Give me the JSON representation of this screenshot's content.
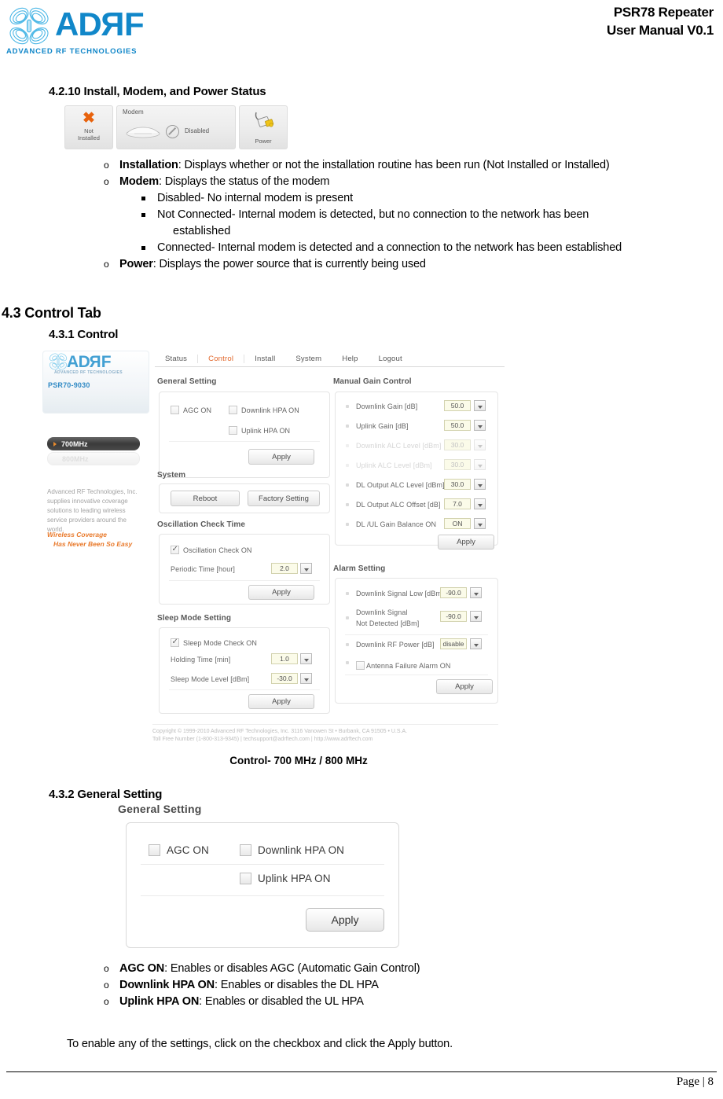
{
  "header": {
    "logo_word_left": "AD",
    "logo_word_r": "R",
    "logo_word_f": "F",
    "logo_tagline": "ADVANCED RF TECHNOLOGIES",
    "doc_title_line1": "PSR78 Repeater",
    "doc_title_line2": "User Manual V0.1"
  },
  "section_4_2_10": {
    "heading": "4.2.10 Install, Modem, and Power Status",
    "status_boxes": {
      "install": {
        "icon": "x-mark-icon",
        "label_line1": "Not",
        "label_line2": "Installed"
      },
      "modem": {
        "title": "Modem",
        "icon": "modem-device-icon",
        "prohibit_icon": "prohibited-icon",
        "status": "Disabled"
      },
      "power": {
        "icon": "power-plug-icon",
        "label": "Power"
      }
    },
    "bullets": [
      {
        "term": "Installation",
        "text": ": Displays whether or not the installation routine has been run (Not Installed or Installed)"
      },
      {
        "term": "Modem",
        "text": ": Displays the status of the modem"
      },
      {
        "term": "Power",
        "text": ": Displays the power source that is currently being used"
      }
    ],
    "sub_bullets": [
      "Disabled- No internal modem is present",
      "Not Connected- Internal modem is detected, but no connection to the network has been",
      "established",
      "Connected- Internal modem is detected and a connection to the network has been established"
    ]
  },
  "section_4_3": {
    "heading": "4.3 Control Tab",
    "sub_heading_431": "4.3.1 Control",
    "sub_heading_432": "4.3.2 General Setting",
    "figure_caption_1": "Control- 700 MHz / 800 MHz"
  },
  "app_screenshot": {
    "nav_tabs": [
      {
        "label": "Status",
        "active": false
      },
      {
        "label": "Control",
        "active": true
      },
      {
        "label": "Install",
        "active": false
      },
      {
        "label": "System",
        "active": false
      },
      {
        "label": "Help",
        "active": false
      },
      {
        "label": "Logout",
        "active": false
      }
    ],
    "sidebar": {
      "logo_left": "AD",
      "logo_r": "R",
      "logo_f": "F",
      "logo_tagline": "ADVANCED RF TECHNOLOGIES",
      "model": "PSR70-9030",
      "band_active": "700MHz",
      "band_inactive": "800MHz",
      "blurb": "Advanced RF Technologies, Inc. supplies innovative coverage solutions to leading wireless service providers around the world.",
      "slogan_line1": "Wireless Coverage",
      "slogan_line2": "Has Never Been So Easy"
    },
    "general_setting": {
      "title": "General Setting",
      "checkboxes": [
        {
          "label": "AGC ON",
          "checked": false
        },
        {
          "label": "Downlink HPA ON",
          "checked": false
        },
        {
          "label": "Uplink HPA ON",
          "checked": false
        }
      ],
      "apply_label": "Apply"
    },
    "system": {
      "title": "System",
      "reboot_label": "Reboot",
      "factory_label": "Factory Setting"
    },
    "oscillation": {
      "title": "Oscillation Check Time",
      "check_label": "Oscillation Check ON",
      "check_checked": true,
      "field_label": "Periodic Time [hour]",
      "field_value": "2.0",
      "apply_label": "Apply"
    },
    "sleep_mode": {
      "title": "Sleep Mode Setting",
      "check_label": "Sleep Mode Check ON",
      "check_checked": true,
      "rows": [
        {
          "label": "Holding Time [min]",
          "value": "1.0"
        },
        {
          "label": "Sleep Mode Level [dBm]",
          "value": "-30.0"
        }
      ],
      "apply_label": "Apply"
    },
    "manual_gain_control": {
      "title": "Manual Gain Control",
      "rows": [
        {
          "label": "Downlink Gain [dB]",
          "value": "50.0",
          "dim": false
        },
        {
          "label": "Uplink Gain [dB]",
          "value": "50.0",
          "dim": false
        },
        {
          "label": "Downlink ALC Level [dBm]",
          "value": "30.0",
          "dim": true
        },
        {
          "label": "Uplink ALC Level [dBm]",
          "value": "30.0",
          "dim": true
        },
        {
          "label": "DL Output ALC Level [dBm]",
          "value": "30.0",
          "dim": false
        },
        {
          "label": "DL Output ALC Offset [dB]",
          "value": "7.0",
          "dim": false
        },
        {
          "label": "DL /UL Gain Balance ON",
          "value": "ON",
          "dim": false
        }
      ],
      "apply_label": "Apply"
    },
    "alarm_setting": {
      "title": "Alarm Setting",
      "rows": [
        {
          "label": "Downlink Signal Low [dBm]",
          "label2": "",
          "value": "-90.0"
        },
        {
          "label": "Downlink Signal",
          "label2": "Not Detected [dBm]",
          "value": "-90.0"
        },
        {
          "label": "Downlink RF Power [dB]",
          "label2": "",
          "value": "disable"
        }
      ],
      "checkbox_label": "Antenna Failure Alarm ON",
      "checkbox_checked": false,
      "apply_label": "Apply"
    },
    "footer": {
      "line1": "Copyright © 1999-2010 Advanced RF Technologies, Inc.   3116 Vanowen St • Burbank, CA 91505 • U.S.A.",
      "line2": "Toll Free Number (1-800-313-9345) | techsupport@adrftech.com | http://www.adrftech.com"
    }
  },
  "general_setting_figure": {
    "title": "General Setting",
    "checkboxes": [
      {
        "label": "AGC ON",
        "checked": false
      },
      {
        "label": "Downlink HPA ON",
        "checked": false
      },
      {
        "label": "Uplink HPA ON",
        "checked": false
      }
    ],
    "apply_label": "Apply"
  },
  "section_4_3_2_bullets": [
    {
      "term": "AGC ON",
      "text": ": Enables or disables AGC (Automatic Gain Control)"
    },
    {
      "term": "Downlink HPA ON",
      "text": ": Enables or disables the DL HPA"
    },
    {
      "term": "Uplink HPA ON",
      "text": ": Enables or disabled the UL HPA"
    }
  ],
  "closing_paragraph": "To enable any of the settings, click on the checkbox and click the Apply button.",
  "page_footer": "Page | 8"
}
